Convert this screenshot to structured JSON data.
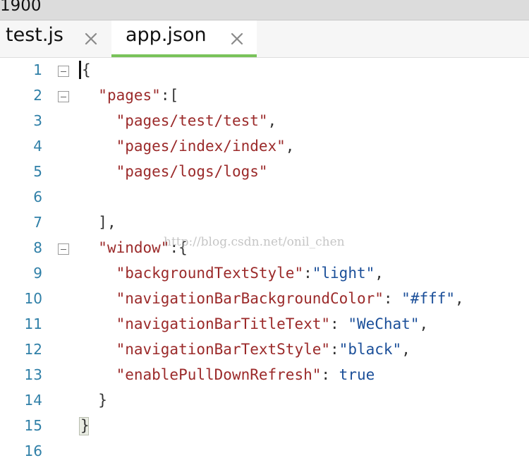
{
  "window": {
    "title_fragment": "1900"
  },
  "tabs": [
    {
      "label": "test.js",
      "active": false
    },
    {
      "label": "app.json",
      "active": true
    }
  ],
  "colors": {
    "active_tab_underline": "#79c35a",
    "line_number": "#2f7fa7",
    "json_key": "#9b2a2a",
    "json_value": "#1b4f99"
  },
  "editor": {
    "language": "json",
    "lines": [
      {
        "n": "1",
        "foldable": true
      },
      {
        "n": "2",
        "foldable": true
      },
      {
        "n": "3",
        "foldable": false
      },
      {
        "n": "4",
        "foldable": false
      },
      {
        "n": "5",
        "foldable": false
      },
      {
        "n": "6",
        "foldable": false
      },
      {
        "n": "7",
        "foldable": false
      },
      {
        "n": "8",
        "foldable": true
      },
      {
        "n": "9",
        "foldable": false
      },
      {
        "n": "10",
        "foldable": false
      },
      {
        "n": "11",
        "foldable": false
      },
      {
        "n": "12",
        "foldable": false
      },
      {
        "n": "13",
        "foldable": false
      },
      {
        "n": "14",
        "foldable": false
      },
      {
        "n": "15",
        "foldable": false
      },
      {
        "n": "16",
        "foldable": false
      }
    ],
    "tokens": {
      "l1_open": "{",
      "l2_indent": "  ",
      "l2_key": "\"pages\"",
      "l2_rest": ":[",
      "l3_indent": "    ",
      "l3_str": "\"pages/test/test\"",
      "l3_rest": ",",
      "l4_indent": "    ",
      "l4_str": "\"pages/index/index\"",
      "l4_rest": ",",
      "l5_indent": "    ",
      "l5_str": "\"pages/logs/logs\"",
      "l7_indent": "  ",
      "l7_rest": "],",
      "l8_indent": "  ",
      "l8_key": "\"window\"",
      "l8_rest": ":{",
      "l9_indent": "    ",
      "l9_key": "\"backgroundTextStyle\"",
      "l9_sep": ":",
      "l9_val": "\"light\"",
      "l9_rest": ",",
      "l10_indent": "    ",
      "l10_key": "\"navigationBarBackgroundColor\"",
      "l10_sep": ": ",
      "l10_val": "\"#fff\"",
      "l10_rest": ",",
      "l11_indent": "    ",
      "l11_key": "\"navigationBarTitleText\"",
      "l11_sep": ": ",
      "l11_val": "\"WeChat\"",
      "l11_rest": ",",
      "l12_indent": "    ",
      "l12_key": "\"navigationBarTextStyle\"",
      "l12_sep": ":",
      "l12_val": "\"black\"",
      "l12_rest": ",",
      "l13_indent": "    ",
      "l13_key": "\"enablePullDownRefresh\"",
      "l13_sep": ": ",
      "l13_val": "true",
      "l14_indent": "  ",
      "l14_rest": "}",
      "l15_close": "}"
    }
  },
  "watermark": "http://blog.csdn.net/onil_chen"
}
